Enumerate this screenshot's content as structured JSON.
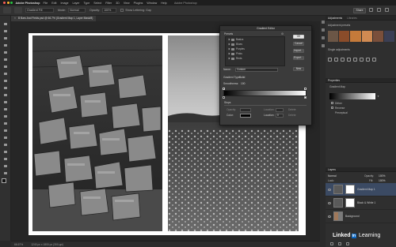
{
  "menubar": {
    "app": "Adobe Photoshop",
    "items": [
      "File",
      "Edit",
      "Image",
      "Layer",
      "Type",
      "Select",
      "Filter",
      "3D",
      "View",
      "Plugins",
      "Window",
      "Help"
    ],
    "window_title": "Adobe Photoshop",
    "traffic_colors": [
      "#ff5f57",
      "#febc2e",
      "#28c840"
    ]
  },
  "options": {
    "gradient_label": "Gradient Fill",
    "mode_label": "Mode:",
    "mode_value": "Normal",
    "opacity_label": "Opacity:",
    "opacity_value": "100%",
    "simulate_label": "Show Lettering: Gap",
    "share_label": "Share"
  },
  "document": {
    "tab_title": "B Bars And Fields.psd @ 66.7% (Gradient Map 1, Layer Mask/8)",
    "status_zoom": "66.67%",
    "status_info": "1240 px x 1800 px (300 ppi)"
  },
  "gradient_editor": {
    "title": "Gradient Editor",
    "presets_label": "Presets",
    "folders": [
      "Basics",
      "Blues",
      "Purples",
      "Pinks",
      "Reds"
    ],
    "ok": "OK",
    "cancel": "Cancel",
    "import": "Import...",
    "export": "Export...",
    "name_label": "Name:",
    "name_value": "Custom",
    "new_button": "New",
    "gradient_type_label": "Gradient Type:",
    "gradient_type_value": "Solid",
    "smoothness_label": "Smoothness:",
    "smoothness_value": "100",
    "stops_label": "Stops",
    "opacity_label": "Opacity:",
    "location_label": "Location:",
    "delete_label": "Delete",
    "color_label": "Color:",
    "location_value": "0"
  },
  "panels": {
    "tab_adjustments": "Adjustments",
    "tab_libraries": "Libraries",
    "adj_presets_title": "Adjustment presets",
    "single_adj_title": "Single adjustments",
    "properties_title": "Properties",
    "props_sub": "Gradient Map",
    "props_row1": "Dither",
    "props_row2": "Reverse",
    "props_method": "Perceptual",
    "layers_title": "Layers",
    "blend_mode": "Normal",
    "opacity_label": "Opacity:",
    "opacity_value": "100%",
    "lock_label": "Lock:",
    "fill_label": "Fill:",
    "fill_value": "100%",
    "layer_names": [
      "Gradient Map 1",
      "Black & White 1",
      "Background"
    ],
    "preset_colors": [
      "#6b5646",
      "#8a4c2a",
      "#c47a3a",
      "#d08a52",
      "#7a4f3b",
      "#3b3f55"
    ]
  },
  "watermark": {
    "brand_left": "Linked",
    "brand_in": "in",
    "brand_right": "Learning"
  }
}
